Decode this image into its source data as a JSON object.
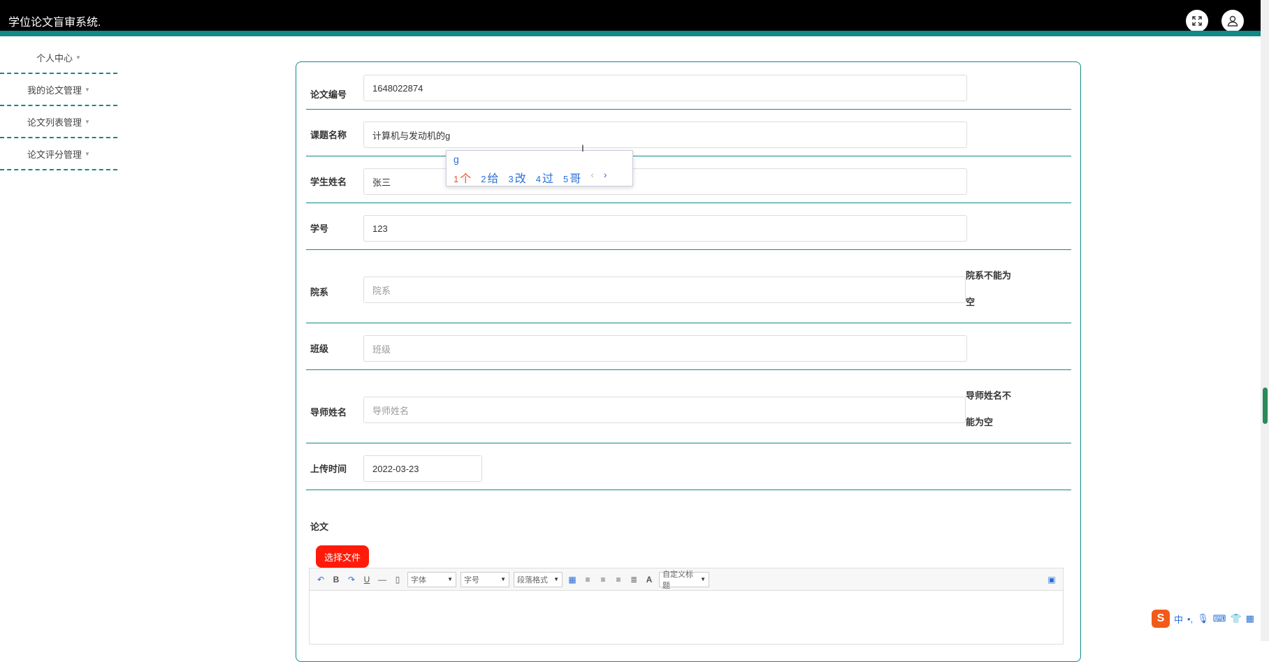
{
  "header": {
    "app_title": "学位论文盲审系统."
  },
  "sidebar": {
    "items": [
      {
        "label": "个人中心"
      },
      {
        "label": "我的论文管理"
      },
      {
        "label": "论文列表管理"
      },
      {
        "label": "论文评分管理"
      }
    ]
  },
  "form": {
    "thesis_no": {
      "label": "论文编号",
      "value": "1648022874"
    },
    "topic": {
      "label": "课题名称",
      "value": "计算机与发动机的g"
    },
    "student_name": {
      "label": "学生姓名",
      "value": "张三"
    },
    "student_id": {
      "label": "学号",
      "value": "123"
    },
    "department": {
      "label": "院系",
      "placeholder": "院系",
      "error": "院系不能为空"
    },
    "class": {
      "label": "班级",
      "placeholder": "班级"
    },
    "advisor": {
      "label": "导师姓名",
      "placeholder": "导师姓名",
      "error": "导师姓名不能为空"
    },
    "upload_time": {
      "label": "上传时间",
      "value": "2022-03-23"
    },
    "thesis": {
      "label": "论文"
    }
  },
  "file_button": "选择文件",
  "editor": {
    "font_select": "字体",
    "size_select": "字号",
    "paragraph_select": "段落格式",
    "custom_title_select": "自定义标题",
    "bold": "B",
    "underline": "U",
    "font_color": "A"
  },
  "ime": {
    "composition": "g",
    "candidates": [
      {
        "n": "1",
        "text": "个"
      },
      {
        "n": "2",
        "text": "给"
      },
      {
        "n": "3",
        "text": "改"
      },
      {
        "n": "4",
        "text": "过"
      },
      {
        "n": "5",
        "text": "哥"
      }
    ],
    "tray_mode": "中",
    "tray_logo": "S"
  }
}
